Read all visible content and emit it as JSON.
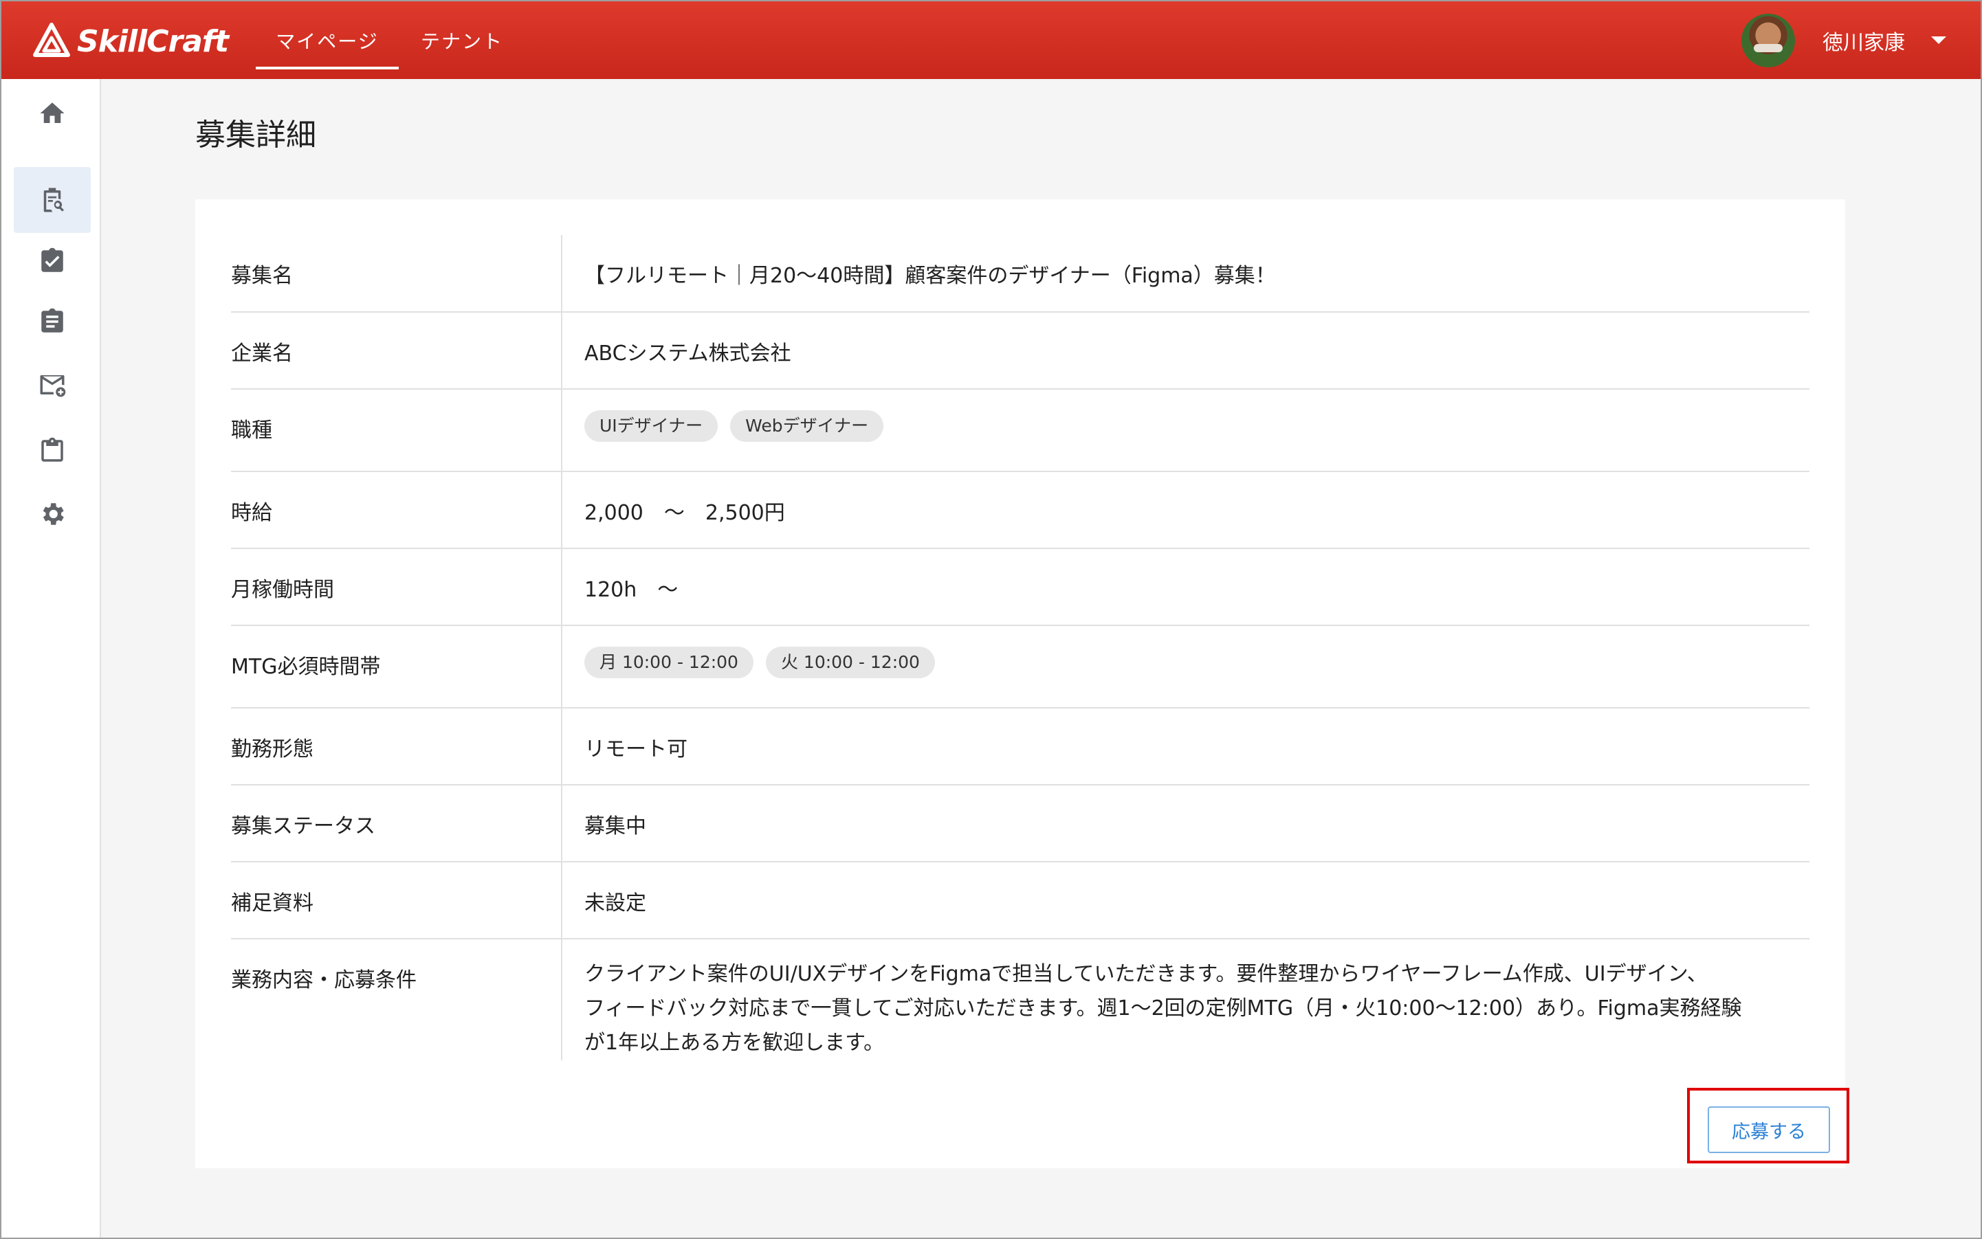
{
  "app": {
    "name": "SkillCraft"
  },
  "header": {
    "tabs": [
      {
        "label": "マイページ",
        "active": true
      },
      {
        "label": "テナント",
        "active": false
      }
    ],
    "user": {
      "name": "徳川家康"
    }
  },
  "sidebar": {
    "items": [
      {
        "icon": "home-icon",
        "active": false
      },
      {
        "icon": "job-search-icon",
        "active": true
      },
      {
        "icon": "task-check-icon",
        "active": false
      },
      {
        "icon": "assignment-icon",
        "active": false
      },
      {
        "icon": "mail-add-icon",
        "active": false
      },
      {
        "icon": "clipboard-icon",
        "active": false
      },
      {
        "icon": "gear-icon",
        "active": false
      }
    ]
  },
  "page": {
    "title": "募集詳細"
  },
  "details": {
    "title": {
      "label": "募集名",
      "value": "【フルリモート｜月20〜40時間】顧客案件のデザイナー（Figma）募集！"
    },
    "company": {
      "label": "企業名",
      "value": "ABCシステム株式会社"
    },
    "job_type": {
      "label": "職種",
      "chips": [
        "UIデザイナー",
        "Webデザイナー"
      ]
    },
    "hourly_wage": {
      "label": "時給",
      "value": "2,000　～　2,500円"
    },
    "monthly_hours": {
      "label": "月稼働時間",
      "value": "120h　～"
    },
    "mtg_time": {
      "label": "MTG必須時間帯",
      "chips": [
        "月 10:00 - 12:00",
        "火 10:00 - 12:00"
      ]
    },
    "work_style": {
      "label": "勤務形態",
      "value": "リモート可"
    },
    "status": {
      "label": "募集ステータス",
      "value": "募集中"
    },
    "materials": {
      "label": "補足資料",
      "value": "未設定"
    },
    "description": {
      "label": "業務内容・応募条件",
      "lines": [
        "クライアント案件のUI/UXデザインをFigmaで担当していただきます。要件整理からワイヤーフレーム作成、UIデザイン、",
        "フィードバック対応まで一貫してご対応いただきます。週1〜2回の定例MTG（月・火10:00〜12:00）あり。Figma実務経験",
        "が1年以上ある方を歓迎します。"
      ]
    }
  },
  "actions": {
    "apply_label": "応募する"
  },
  "colors": {
    "header": "#d32f2f",
    "accent": "#2a7fd4",
    "highlight": "#e00000"
  }
}
